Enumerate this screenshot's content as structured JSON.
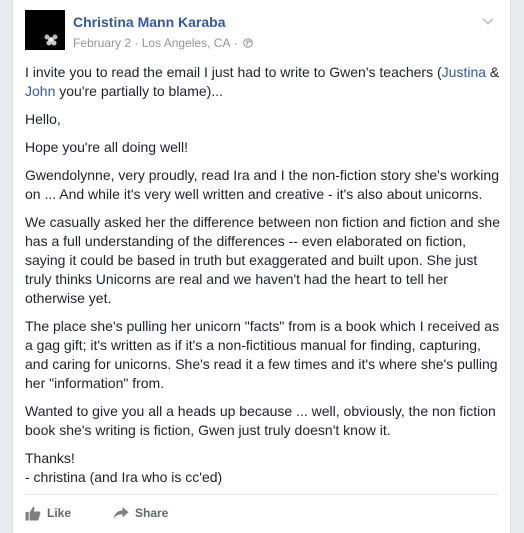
{
  "post": {
    "author": "Christina Mann Karaba",
    "date": "February 2",
    "location": "Los Angeles, CA",
    "separator": "·",
    "privacy_icon": "globe-icon",
    "intro_before": "I invite you to read the email I just had to write to Gwen's teachers (",
    "mention_1": "Justina",
    "intro_amp": " & ",
    "mention_2": "John",
    "intro_after": " you're partially to blame)...",
    "paragraphs": [
      "Hello,",
      "Hope you're all doing well!",
      "Gwendolynne, very proudly, read Ira and I the non-fiction story she's working on ... And while it's very well written and creative - it's also about unicorns.",
      "We casually asked her the difference between non fiction and fiction and she has a full understanding of the differences -- even elaborated on fiction, saying it could be based in truth but exaggerated and built upon. She just truly thinks Unicorns are real and we haven't had the heart to tell her otherwise yet.",
      "The place she's pulling her unicorn \"facts\" from is a book which I received as a gag gift; it's written as if it's a non-fictitious manual for finding, capturing, and caring for unicorns. She's read it a few times and it's where she's pulling her \"information\" from.",
      "Wanted to give you all a heads up because ... well, obviously, the non fiction book she's writing is fiction, Gwen just truly doesn't know it."
    ],
    "signoff_1": "Thanks!",
    "signoff_2": "- christina (and Ira who is cc'ed)"
  },
  "actions": {
    "like_label": "Like",
    "share_label": "Share"
  },
  "colors": {
    "link": "#365899",
    "meta": "#90949c",
    "text": "#1d2129",
    "action": "#606770"
  }
}
